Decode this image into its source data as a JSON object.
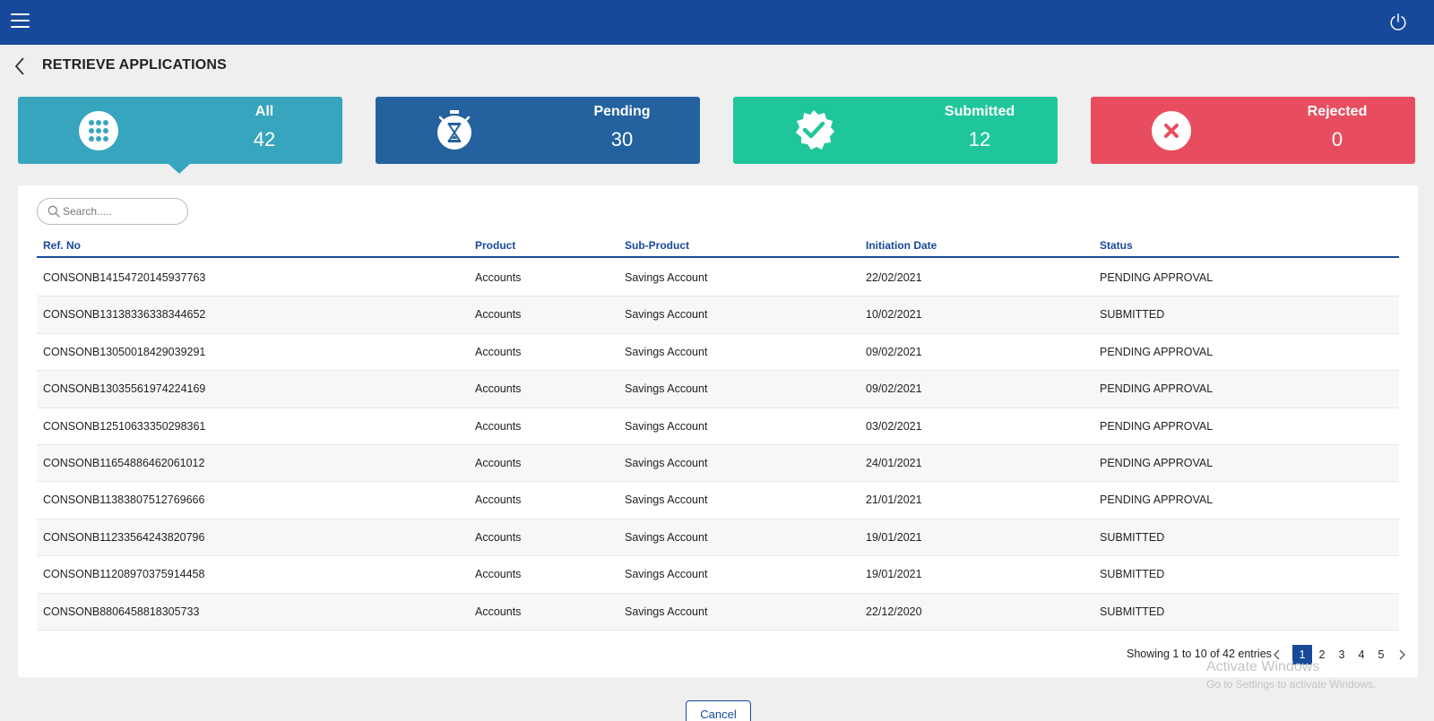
{
  "header": {
    "menu_icon": "hamburger-menu-icon",
    "power_icon": "power-icon"
  },
  "page": {
    "title": "RETRIEVE APPLICATIONS",
    "back_icon": "chevron-left-icon"
  },
  "summary": {
    "all": {
      "label": "All",
      "count": "42",
      "icon": "grid-dots-icon",
      "color": "#37a5bd"
    },
    "pending": {
      "label": "Pending",
      "count": "30",
      "icon": "stopwatch-hourglass-icon",
      "color": "#23629f"
    },
    "submitted": {
      "label": "Submitted",
      "count": "12",
      "icon": "verified-badge-check-icon",
      "color": "#20c69b"
    },
    "rejected": {
      "label": "Rejected",
      "count": "0",
      "icon": "close-circle-icon",
      "color": "#e84d5f"
    }
  },
  "search": {
    "placeholder": "Search.....",
    "value": ""
  },
  "table": {
    "columns": [
      "Ref. No",
      "Product",
      "Sub-Product",
      "Initiation Date",
      "Status"
    ],
    "rows": [
      [
        "CONSONB14154720145937763",
        "Accounts",
        "Savings Account",
        "22/02/2021",
        "PENDING APPROVAL"
      ],
      [
        "CONSONB13138336338344652",
        "Accounts",
        "Savings Account",
        "10/02/2021",
        "SUBMITTED"
      ],
      [
        "CONSONB13050018429039291",
        "Accounts",
        "Savings Account",
        "09/02/2021",
        "PENDING APPROVAL"
      ],
      [
        "CONSONB13035561974224169",
        "Accounts",
        "Savings Account",
        "09/02/2021",
        "PENDING APPROVAL"
      ],
      [
        "CONSONB12510633350298361",
        "Accounts",
        "Savings Account",
        "03/02/2021",
        "PENDING APPROVAL"
      ],
      [
        "CONSONB11654886462061012",
        "Accounts",
        "Savings Account",
        "24/01/2021",
        "PENDING APPROVAL"
      ],
      [
        "CONSONB11383807512769666",
        "Accounts",
        "Savings Account",
        "21/01/2021",
        "PENDING APPROVAL"
      ],
      [
        "CONSONB11233564243820796",
        "Accounts",
        "Savings Account",
        "19/01/2021",
        "SUBMITTED"
      ],
      [
        "CONSONB11208970375914458",
        "Accounts",
        "Savings Account",
        "19/01/2021",
        "SUBMITTED"
      ],
      [
        "CONSONB8806458818305733",
        "Accounts",
        "Savings Account",
        "22/12/2020",
        "SUBMITTED"
      ]
    ]
  },
  "pagination": {
    "info": "Showing 1 to 10 of 42 entries",
    "pages": [
      "1",
      "2",
      "3",
      "4",
      "5"
    ],
    "current": "1"
  },
  "watermark": {
    "line1": "Activate Windows",
    "line2": "Go to Settings to activate Windows."
  },
  "actions": {
    "cancel_label": "Cancel"
  },
  "colors": {
    "primary": "#17499b",
    "page_bg": "#efefef"
  }
}
